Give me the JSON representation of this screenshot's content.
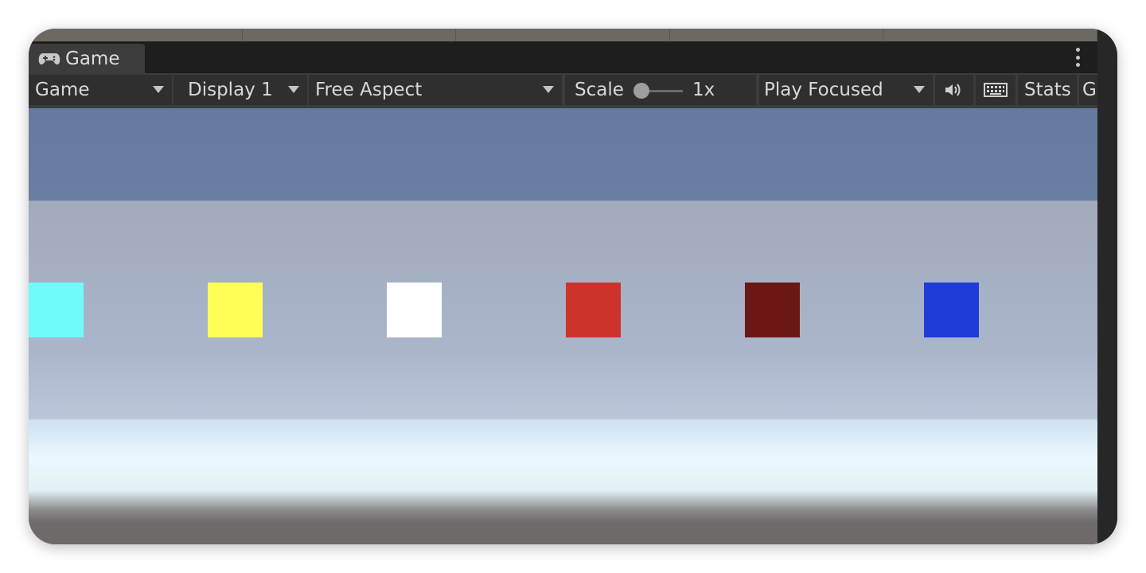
{
  "window": {
    "tab_label": "Game",
    "tab_icon": "gamepad-icon",
    "menu_icon": "kebab-menu-icon"
  },
  "toolbar": {
    "view_mode": "Game",
    "display": "Display 1",
    "aspect": "Free Aspect",
    "scale_label": "Scale",
    "scale_value": "1x",
    "play_mode": "Play Focused",
    "audio_icon": "speaker-icon",
    "keyboard_icon": "keyboard-icon",
    "stats_label": "Stats",
    "gizmos_label": "G"
  },
  "scene": {
    "cubes": [
      {
        "name": "cyan-cube",
        "color": "#6ffbfb"
      },
      {
        "name": "yellow-cube",
        "color": "#fefe56"
      },
      {
        "name": "white-cube",
        "color": "#ffffff"
      },
      {
        "name": "red-cube",
        "color": "#cc342b"
      },
      {
        "name": "dark-red-cube",
        "color": "#6b1714"
      },
      {
        "name": "blue-cube",
        "color": "#203cd7"
      }
    ]
  }
}
